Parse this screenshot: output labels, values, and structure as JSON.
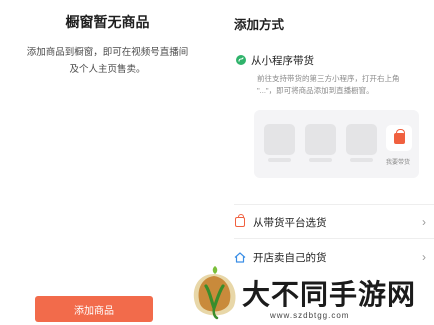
{
  "left": {
    "title": "橱窗暂无商品",
    "desc_line1": "添加商品到橱窗，即可在视频号直播间",
    "desc_line2": "及个人主页售卖。",
    "button_label": "添加商品"
  },
  "right": {
    "title": "添加方式",
    "mini_program": {
      "title": "从小程序带货",
      "desc_line1": "前往支持带货的第三方小程序，打开右上角",
      "desc_line2": "\"...\"，即可将商品添加到直播橱窗。",
      "shop_label": "我要带货"
    },
    "rows": [
      {
        "label": "从带货平台选货",
        "chevron": "›"
      },
      {
        "label": "开店卖自己的货",
        "chevron": "›"
      }
    ]
  },
  "watermark": {
    "text": "大不同手游网",
    "url": "www.szdbtgg.com"
  },
  "icons": {
    "mini_program": "mini-program-icon",
    "platform": "shopping-bag-icon",
    "shop": "house-icon"
  },
  "colors": {
    "accent": "#f26b4b",
    "mini_program_green": "#2fb36b",
    "shop_blue": "#3a8ee6"
  }
}
